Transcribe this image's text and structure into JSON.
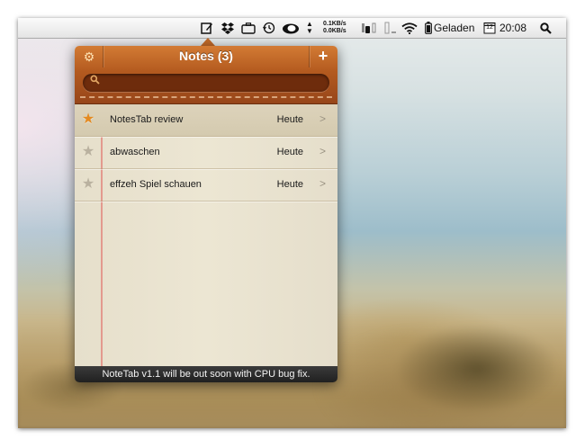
{
  "menubar": {
    "tray_icons": [
      "notetab-icon",
      "dropbox-icon",
      "briefcase-icon",
      "time-machine-icon",
      "cloud-temperature-icon",
      "up-down-arrows-icon"
    ],
    "net_up": "0.1KB/s",
    "net_down": "0.0KB/s",
    "battery_label": "Geladen",
    "clock": "20:08",
    "calendar_day": "12"
  },
  "popup": {
    "title": "Notes (3)",
    "search": {
      "value": "",
      "placeholder": ""
    },
    "accent_color": "#b35a1f",
    "notes": [
      {
        "title": "NotesTab review",
        "date": "Heute",
        "starred": true
      },
      {
        "title": "abwaschen",
        "date": "Heute",
        "starred": false
      },
      {
        "title": "effzeh Spiel schauen",
        "date": "Heute",
        "starred": false
      }
    ],
    "footer": "NoteTab v1.1 will be out soon with CPU bug fix."
  }
}
